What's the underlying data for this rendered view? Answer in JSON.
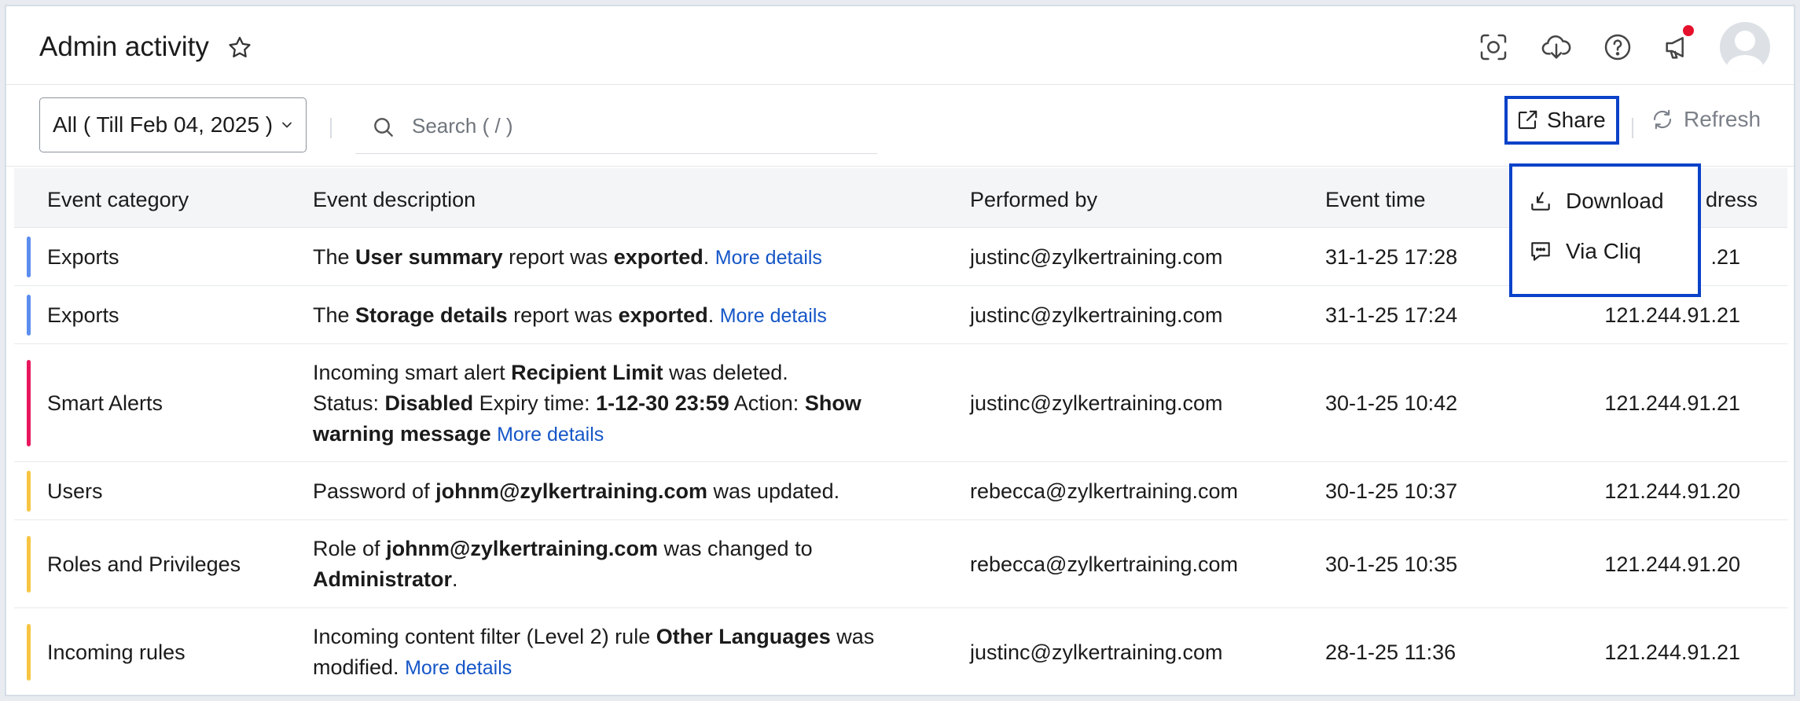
{
  "header": {
    "title": "Admin activity"
  },
  "toolbar": {
    "period_label": "All ( Till Feb 04, 2025 )",
    "search_placeholder": "Search ( / )",
    "share_label": "Share",
    "refresh_label": "Refresh"
  },
  "share_menu": {
    "items": [
      {
        "label": "Download",
        "icon": "download-icon"
      },
      {
        "label": "Via Cliq",
        "icon": "chat-icon"
      }
    ]
  },
  "table": {
    "columns": [
      "Event category",
      "Event description",
      "Performed by",
      "Event time",
      "dress"
    ],
    "rows": [
      {
        "category": "Exports",
        "bar_color": "#5b8def",
        "desc_html": "The <b>User summary</b> report was <b>exported</b>.",
        "more": "More details",
        "performed_by": "justinc@zylkertraining.com",
        "time": "31-1-25 17:28",
        "ip": ".21"
      },
      {
        "category": "Exports",
        "bar_color": "#5b8def",
        "desc_html": "The <b>Storage details</b> report was <b>exported</b>.",
        "more": "More details",
        "performed_by": "justinc@zylkertraining.com",
        "time": "31-1-25 17:24",
        "ip": "121.244.91.21"
      },
      {
        "category": "Smart Alerts",
        "bar_color": "#e8175d",
        "desc_html": "Incoming smart alert <b>Recipient Limit</b> was deleted.<br>Status: <b>Disabled</b> Expiry time: <b>1-12-30 23:59</b> Action: <b>Show</b><br><b>warning message</b>",
        "more": "More details",
        "performed_by": "justinc@zylkertraining.com",
        "time": "30-1-25 10:42",
        "ip": "121.244.91.21"
      },
      {
        "category": "Users",
        "bar_color": "#f7c542",
        "desc_html": "Password of <b>johnm@zylkertraining.com</b> was updated.",
        "more": "",
        "performed_by": "rebecca@zylkertraining.com",
        "time": "30-1-25 10:37",
        "ip": "121.244.91.20"
      },
      {
        "category": "Roles and Privileges",
        "bar_color": "#f7c542",
        "desc_html": "Role of <b>johnm@zylkertraining.com</b> was changed to<br><b>Administrator</b>.",
        "more": "",
        "performed_by": "rebecca@zylkertraining.com",
        "time": "30-1-25 10:35",
        "ip": "121.244.91.20"
      },
      {
        "category": "Incoming rules",
        "bar_color": "#f7c542",
        "desc_html": "Incoming content filter (Level 2) rule <b>Other Languages</b> was<br>modified.",
        "more": "More details",
        "performed_by": "justinc@zylkertraining.com",
        "time": "28-1-25 11:36",
        "ip": "121.244.91.21"
      }
    ]
  },
  "colors": {
    "accent_border": "#0a42c9",
    "link": "#1556c7",
    "notification": "#e5102c"
  }
}
